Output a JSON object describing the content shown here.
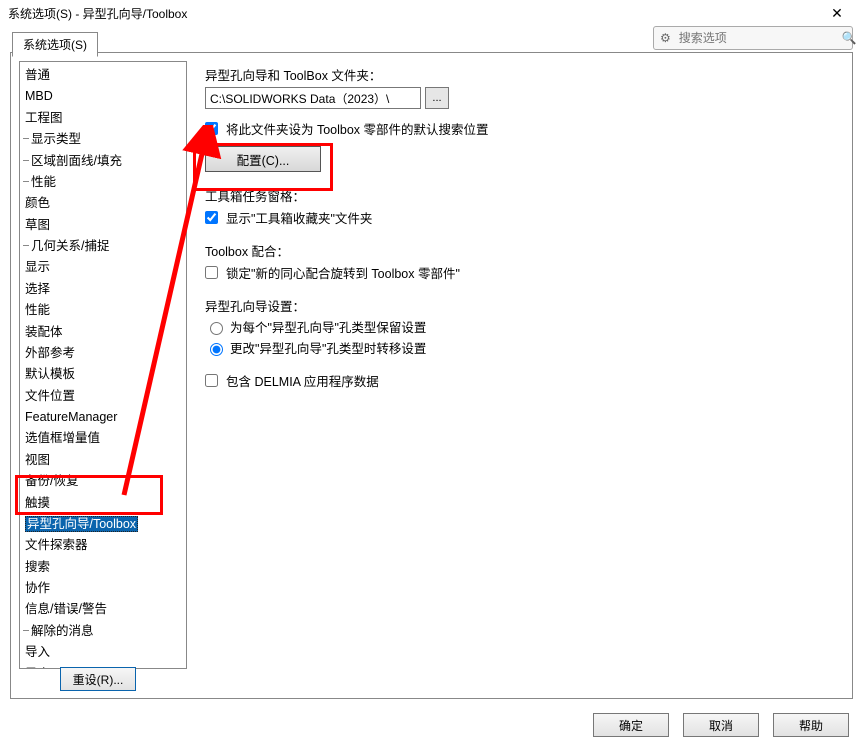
{
  "title": "系统选项(S) - 异型孔向导/Toolbox",
  "search": {
    "placeholder": "搜索选项"
  },
  "tab": {
    "label": "系统选项(S)"
  },
  "tree": {
    "items": [
      {
        "label": "普通",
        "level": 1
      },
      {
        "label": "MBD",
        "level": 1
      },
      {
        "label": "工程图",
        "level": 1
      },
      {
        "label": "显示类型",
        "level": 2
      },
      {
        "label": "区域剖面线/填充",
        "level": 2
      },
      {
        "label": "性能",
        "level": 2
      },
      {
        "label": "颜色",
        "level": 1
      },
      {
        "label": "草图",
        "level": 1
      },
      {
        "label": "几何关系/捕捉",
        "level": 2
      },
      {
        "label": "显示",
        "level": 1
      },
      {
        "label": "选择",
        "level": 1
      },
      {
        "label": "性能",
        "level": 1
      },
      {
        "label": "装配体",
        "level": 1
      },
      {
        "label": "外部参考",
        "level": 1
      },
      {
        "label": "默认模板",
        "level": 1
      },
      {
        "label": "文件位置",
        "level": 1
      },
      {
        "label": "FeatureManager",
        "level": 1
      },
      {
        "label": "选值框增量值",
        "level": 1
      },
      {
        "label": "视图",
        "level": 1
      },
      {
        "label": "备份/恢复",
        "level": 1
      },
      {
        "label": "触摸",
        "level": 1
      },
      {
        "label": "异型孔向导/Toolbox",
        "level": 1,
        "selected": true
      },
      {
        "label": "文件探索器",
        "level": 1
      },
      {
        "label": "搜索",
        "level": 1
      },
      {
        "label": "协作",
        "level": 1
      },
      {
        "label": "信息/错误/警告",
        "level": 1
      },
      {
        "label": "解除的消息",
        "level": 2
      },
      {
        "label": "导入",
        "level": 1
      },
      {
        "label": "导出",
        "level": 1
      }
    ]
  },
  "detail": {
    "folder_label": "异型孔向导和 ToolBox 文件夹：",
    "folder_value": "C:\\SOLIDWORKS Data（2023）\\",
    "default_search_label": "将此文件夹设为 Toolbox 零部件的默认搜索位置",
    "config_label": "配置(C)...",
    "task_label": "工具箱任务窗格：",
    "show_fav_label": "显示\"工具箱收藏夹\"文件夹",
    "mate_label": "Toolbox 配合：",
    "lock_label": "锁定\"新的同心配合旋转到 Toolbox 零部件\"",
    "hw_label": "异型孔向导设置：",
    "radio1": "为每个\"异型孔向导\"孔类型保留设置",
    "radio2": "更改\"异型孔向导\"孔类型时转移设置",
    "delmia_label": "包含 DELMIA 应用程序数据"
  },
  "buttons": {
    "reset": "重设(R)...",
    "ok": "确定",
    "cancel": "取消",
    "help": "帮助"
  }
}
